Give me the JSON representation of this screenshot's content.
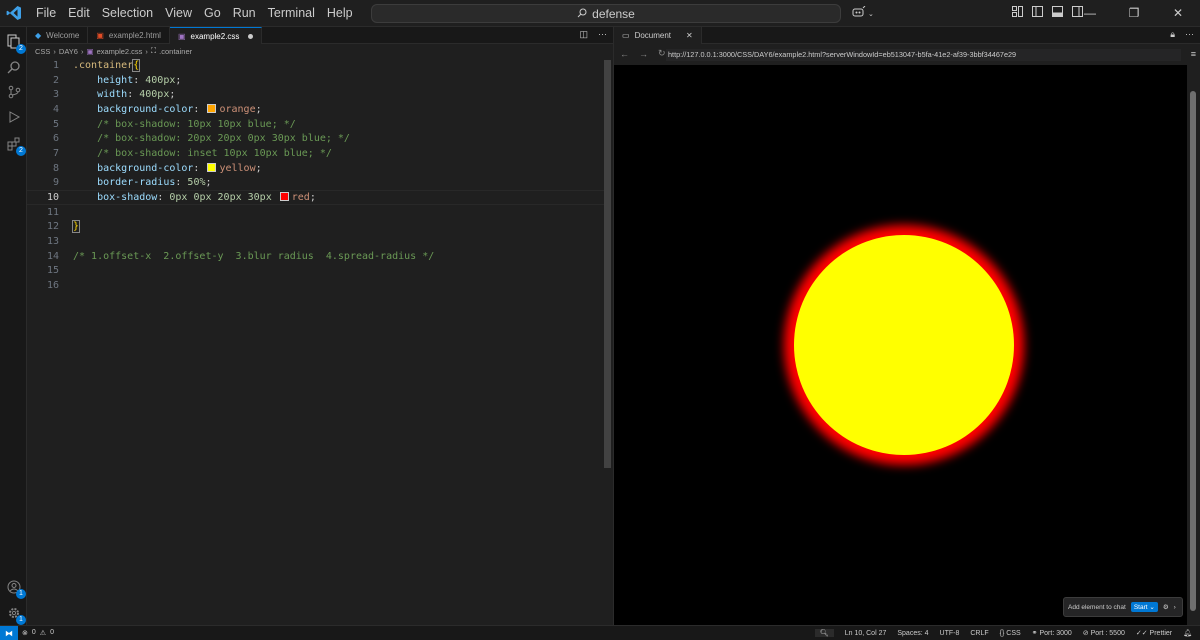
{
  "menu": [
    "File",
    "Edit",
    "Selection",
    "View",
    "Go",
    "Run",
    "Terminal",
    "Help"
  ],
  "search": {
    "text": "defense"
  },
  "activity_badges": {
    "explorer": "2",
    "extensions": "2",
    "accounts": "1",
    "settings": "1"
  },
  "editor": {
    "tabs": [
      {
        "label": "Welcome"
      },
      {
        "label": "example2.html"
      },
      {
        "label": "example2.css"
      }
    ],
    "breadcrumb": [
      "CSS",
      "DAY6",
      "example2.css",
      ".container"
    ],
    "line_numbers": [
      "1",
      "2",
      "3",
      "4",
      "5",
      "6",
      "7",
      "8",
      "9",
      "10",
      "11",
      "12",
      "13",
      "14",
      "15",
      "16"
    ],
    "code": {
      "l1_selector": ".container",
      "l1_brace": "{",
      "l2_prop": "height",
      "l2_val": "400px",
      "l3_prop": "width",
      "l3_val": "400px",
      "l4_prop": "background-color",
      "l4_val": "orange",
      "l5": "/* box-shadow: 10px 10px blue; */",
      "l6": "/* box-shadow: 20px 20px 0px 30px blue; */",
      "l7": "/* box-shadow: inset 10px 10px blue; */",
      "l8_prop": "background-color",
      "l8_val": "yellow",
      "l9_prop": "border-radius",
      "l9_val": "50%",
      "l10_prop": "box-shadow",
      "l10_nums": "0px 0px 20px 30px",
      "l10_val": "red",
      "l12_brace": "}",
      "l14": "/* 1.offset-x  2.offset-y  3.blur radius  4.spread-radius */"
    }
  },
  "browser": {
    "tab_label": "Document",
    "url": "http://127.0.0.1:3000/CSS/DAY6/example2.html?serverWindowId=eb513047-b5fa-41e2-af39-3bbf34467e29",
    "chat": {
      "label": "Add element to chat",
      "start": "Start"
    }
  },
  "status": {
    "problems": "0",
    "warnings": "0",
    "position": "Ln 10, Col 27",
    "spaces": "Spaces: 4",
    "encoding": "UTF-8",
    "eol": "CRLF",
    "language": "CSS",
    "port1": "Port: 3000",
    "port2": "Port : 5500",
    "prettier": "Prettier"
  },
  "colors": {
    "accent": "#0078d4",
    "swatch_orange": "#ffa500",
    "swatch_yellow": "#ffff00",
    "swatch_red": "#ff0000",
    "circle_fill": "#ffff00",
    "circle_glow": "#ff0000"
  }
}
